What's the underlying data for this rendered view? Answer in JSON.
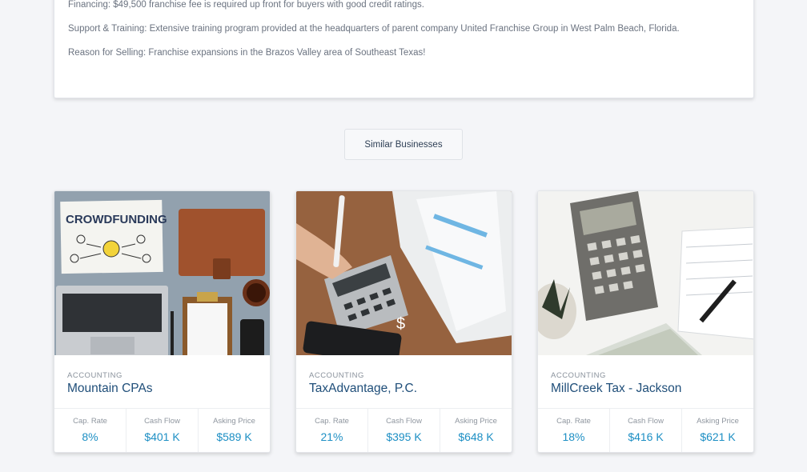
{
  "description": {
    "lines": [
      "Financing: $49,500 franchise fee is required up front for buyers with good credit ratings.",
      "Support & Training: Extensive training program provided at the headquarters of parent company United Franchise Group in West Palm Beach, Florida.",
      "Reason for Selling: Franchise expansions in the Brazos Valley area of Southeast Texas!"
    ]
  },
  "similar_button": {
    "label": "Similar Businesses"
  },
  "cards": [
    {
      "image": "crowdfunding-desk-photo",
      "image_text": "CROWDFUNDING",
      "category": "ACCOUNTING",
      "title": "Mountain CPAs",
      "stats": [
        {
          "label": "Cap. Rate",
          "value": "8%"
        },
        {
          "label": "Cash Flow",
          "value": "$401 K"
        },
        {
          "label": "Asking Price",
          "value": "$589 K"
        }
      ]
    },
    {
      "image": "calculator-invoice-photo",
      "image_text": "$",
      "category": "ACCOUNTING",
      "title": "TaxAdvantage, P.C.",
      "stats": [
        {
          "label": "Cap. Rate",
          "value": "21%"
        },
        {
          "label": "Cash Flow",
          "value": "$395 K"
        },
        {
          "label": "Asking Price",
          "value": "$648 K"
        }
      ]
    },
    {
      "image": "calculator-cash-photo",
      "category": "ACCOUNTING",
      "title": "MillCreek Tax - Jackson",
      "stats": [
        {
          "label": "Cap. Rate",
          "value": "18%"
        },
        {
          "label": "Cash Flow",
          "value": "$416 K"
        },
        {
          "label": "Asking Price",
          "value": "$621 K"
        }
      ]
    }
  ]
}
